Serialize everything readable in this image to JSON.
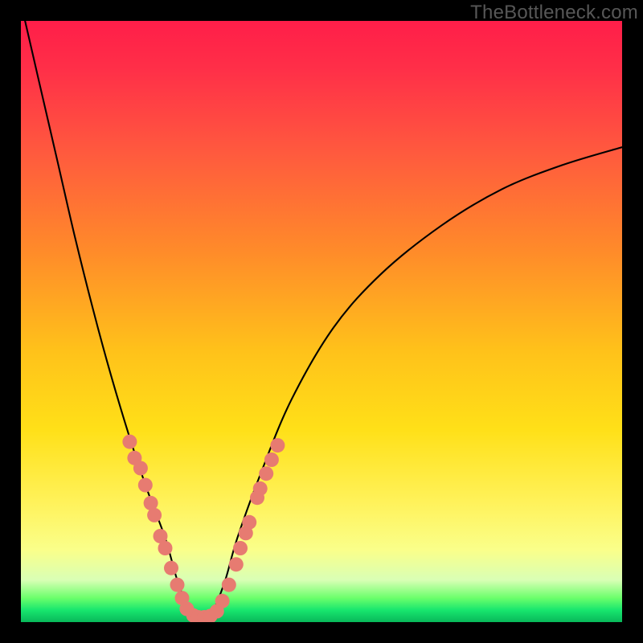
{
  "watermark": "TheBottleneck.com",
  "colors": {
    "frame": "#000000",
    "watermark_text": "#575757",
    "curve": "#000000",
    "marker": "#e77b71",
    "gradient_stops": [
      {
        "offset": 0.0,
        "color": "#ff1e49"
      },
      {
        "offset": 0.08,
        "color": "#ff2f48"
      },
      {
        "offset": 0.22,
        "color": "#ff5a3e"
      },
      {
        "offset": 0.38,
        "color": "#ff8a2a"
      },
      {
        "offset": 0.55,
        "color": "#ffc21a"
      },
      {
        "offset": 0.68,
        "color": "#ffe018"
      },
      {
        "offset": 0.8,
        "color": "#fff25a"
      },
      {
        "offset": 0.88,
        "color": "#faff8a"
      },
      {
        "offset": 0.93,
        "color": "#d9ffb5"
      },
      {
        "offset": 0.96,
        "color": "#6bff6b"
      },
      {
        "offset": 0.98,
        "color": "#18e66e"
      },
      {
        "offset": 1.0,
        "color": "#08b85a"
      }
    ]
  },
  "chart_data": {
    "type": "line",
    "title": "",
    "xlabel": "",
    "ylabel": "",
    "x_range": [
      0,
      1
    ],
    "y_range": [
      0,
      1
    ],
    "note": "Axes unlabeled; values read as normalized (0–1) fractions of the plot area. y=0 is the bottom (green), y=1 is the top (red). Curve is a V-shape with minimum near x≈0.30.",
    "series": [
      {
        "name": "bottleneck-curve",
        "x": [
          0.0,
          0.03,
          0.06,
          0.09,
          0.12,
          0.15,
          0.18,
          0.21,
          0.24,
          0.26,
          0.28,
          0.3,
          0.32,
          0.34,
          0.36,
          0.4,
          0.45,
          0.52,
          0.6,
          0.7,
          0.8,
          0.9,
          1.0
        ],
        "y": [
          1.03,
          0.9,
          0.77,
          0.64,
          0.52,
          0.41,
          0.31,
          0.22,
          0.14,
          0.07,
          0.02,
          0.0,
          0.02,
          0.07,
          0.14,
          0.25,
          0.37,
          0.49,
          0.58,
          0.66,
          0.72,
          0.76,
          0.79
        ]
      }
    ],
    "markers": {
      "name": "highlighted-points",
      "shape": "circle",
      "color": "#e77b71",
      "radius_px": 9,
      "points_xy": [
        [
          0.181,
          0.3
        ],
        [
          0.189,
          0.273
        ],
        [
          0.199,
          0.256
        ],
        [
          0.207,
          0.228
        ],
        [
          0.216,
          0.198
        ],
        [
          0.222,
          0.178
        ],
        [
          0.232,
          0.143
        ],
        [
          0.24,
          0.123
        ],
        [
          0.25,
          0.09
        ],
        [
          0.26,
          0.062
        ],
        [
          0.268,
          0.04
        ],
        [
          0.276,
          0.022
        ],
        [
          0.287,
          0.011
        ],
        [
          0.295,
          0.008
        ],
        [
          0.305,
          0.008
        ],
        [
          0.315,
          0.01
        ],
        [
          0.326,
          0.018
        ],
        [
          0.335,
          0.035
        ],
        [
          0.346,
          0.062
        ],
        [
          0.358,
          0.096
        ],
        [
          0.365,
          0.123
        ],
        [
          0.374,
          0.148
        ],
        [
          0.38,
          0.166
        ],
        [
          0.393,
          0.207
        ],
        [
          0.398,
          0.222
        ],
        [
          0.408,
          0.247
        ],
        [
          0.417,
          0.27
        ],
        [
          0.427,
          0.294
        ]
      ]
    }
  }
}
